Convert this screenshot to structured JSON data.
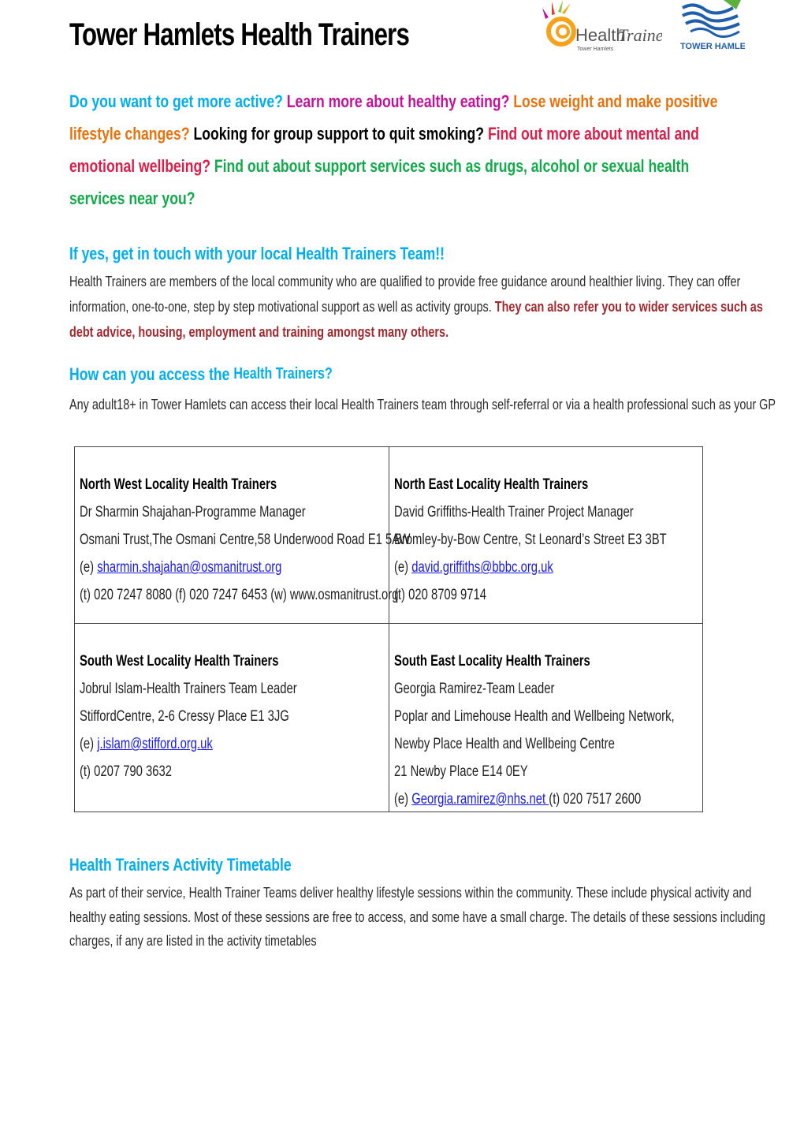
{
  "header": {
    "title": "Tower Hamlets Health Trainers",
    "logos": [
      {
        "name": "health-trainers-logo",
        "text": "Health",
        "script_text": "Trainers",
        "sub": "Tower Hamlets"
      },
      {
        "name": "tower-hamlets-logo",
        "text": "TOWER HAMLETS"
      }
    ]
  },
  "intro": {
    "lines": [
      [
        {
          "text": "Do you want to get more active? ",
          "color": "blue"
        },
        {
          "text": "Learn more about healthy eating? ",
          "color": "magenta"
        },
        {
          "text": "Lose weight and make positive",
          "color": "orange"
        }
      ],
      [
        {
          "text": "lifestyle changes? ",
          "color": "orange"
        },
        {
          "text": "Looking for group support to quit smoking? ",
          "color": "black"
        },
        {
          "text": "Find out more about mental and",
          "color": "red"
        }
      ],
      [
        {
          "text": "emotional wellbeing? ",
          "color": "red"
        },
        {
          "text": "Find out about support services such as drugs, alcohol or sexual health",
          "color": "green"
        }
      ],
      [
        {
          "text": "services near you?",
          "color": "green"
        }
      ]
    ]
  },
  "get_in_touch": {
    "heading": "If yes, get in touch with your local Health Trainers Team!!",
    "line1": "Health Trainers are members of the local community who are qualified to provide free guidance around healthier living. They can offer",
    "line2_plain": "information, one-to-one, step by step motivational support as well as activity groups. ",
    "line2_bold": "They can also refer you to wider services such as",
    "line3_bold": "debt advice, housing, employment and training amongst many others."
  },
  "access": {
    "heading_a": "How can you access the ",
    "heading_b": "Health Trainers?",
    "text": "Any adult18+ in Tower Hamlets can access their local Health Trainers team through self-referral or via a health professional such as your GP"
  },
  "localities": [
    {
      "title": "North West Locality Health Trainers",
      "contact": "Dr Sharmin Shajahan-Programme Manager",
      "address": [
        "Osmani Trust,The Osmani Centre,58 Underwood Road E1 5AW"
      ],
      "email_prefix": "(e) ",
      "email": "sharmin.shajahan@osmanitrust.org",
      "email_suffix": "",
      "phone": "(t) 020 7247 8080 (f) 020 7247 6453 (w) www.osmanitrust.org"
    },
    {
      "title": "North East Locality Health Trainers",
      "contact": "David Griffiths-Health Trainer Project Manager",
      "address": [
        "Bromley-by-Bow Centre, St Leonard’s Street E3 3BT"
      ],
      "email_prefix": "(e) ",
      "email": "david.griffiths@bbbc.org.uk",
      "email_suffix": "",
      "phone": "(t)  020 8709 9714"
    },
    {
      "title": "South West Locality Health Trainers",
      "contact": "Jobrul Islam-Health Trainers Team Leader",
      "address": [
        "StiffordCentre, 2-6 Cressy Place E1 3JG"
      ],
      "email_prefix": "(e) ",
      "email": "j.islam@stifford.org.uk",
      "email_suffix": "",
      "phone": "(t) 0207 790 3632"
    },
    {
      "title": "South East Locality Health Trainers",
      "contact": "Georgia Ramirez-Team Leader",
      "address": [
        "Poplar and Limehouse Health and Wellbeing Network,",
        "Newby Place Health and Wellbeing Centre",
        "21 Newby Place E14 0EY"
      ],
      "email_prefix": "(e) ",
      "email": "Georgia.ramirez@nhs.net ",
      "email_suffix": "(t) 020 7517 2600",
      "phone": ""
    }
  ],
  "timetable": {
    "heading": "Health Trainers Activity Timetable",
    "lines": [
      "As part of their service, Health Trainer Teams deliver healthy lifestyle sessions within the community. These include physical activity and",
      "healthy eating sessions. Most of these sessions are free to access, and some have a small charge. The details of these sessions including",
      "charges, if any are listed in the activity timetables"
    ]
  },
  "colors": {
    "blue": "#00AEEF",
    "magenta": "#C4119A",
    "orange": "#E8720C",
    "black": "#000000",
    "red": "#DC1E4A",
    "green": "#12AA4A",
    "maroon": "#A3282E",
    "link": "#1A1AE6"
  }
}
